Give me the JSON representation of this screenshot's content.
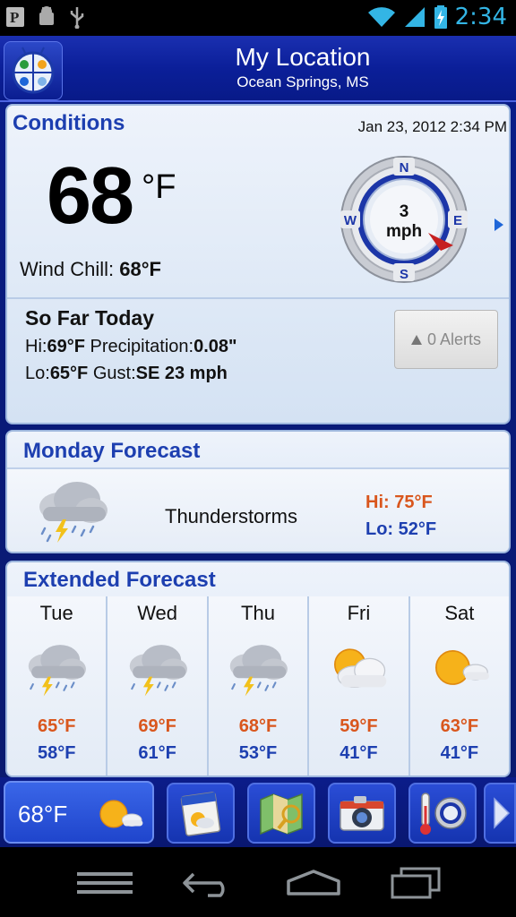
{
  "status_bar": {
    "time": "2:34"
  },
  "header": {
    "title": "My Location",
    "subtitle": "Ocean Springs, MS"
  },
  "conditions": {
    "heading": "Conditions",
    "datetime": "Jan 23, 2012 2:34 PM",
    "temperature": "68",
    "unit": "°F",
    "wind_chill_label": "Wind Chill: ",
    "wind_chill_value": "68°F",
    "wind": {
      "speed": "3",
      "unit": "mph",
      "directions": {
        "n": "N",
        "e": "E",
        "s": "S",
        "w": "W"
      }
    },
    "so_far_today": {
      "heading": "So Far Today",
      "hi_label": "Hi:",
      "hi_value": "69°F",
      "precip_label": "Precipitation:",
      "precip_value": "0.08\"",
      "lo_label": "Lo:",
      "lo_value": "65°F",
      "gust_label": "Gust:",
      "gust_value": "SE 23 mph"
    },
    "alerts_label": "0 Alerts"
  },
  "today_forecast": {
    "heading": "Monday Forecast",
    "condition": "Thunderstorms",
    "hi": "Hi: 75°F",
    "lo": "Lo: 52°F"
  },
  "extended": {
    "heading": "Extended Forecast",
    "days": [
      {
        "name": "Tue",
        "icon": "thunderstorm-icon",
        "hi": "65°F",
        "lo": "58°F"
      },
      {
        "name": "Wed",
        "icon": "thunderstorm-icon",
        "hi": "69°F",
        "lo": "61°F"
      },
      {
        "name": "Thu",
        "icon": "thunderstorm-icon",
        "hi": "68°F",
        "lo": "53°F"
      },
      {
        "name": "Fri",
        "icon": "partly-cloudy-icon",
        "hi": "59°F",
        "lo": "41°F"
      },
      {
        "name": "Sat",
        "icon": "mostly-sunny-icon",
        "hi": "63°F",
        "lo": "41°F"
      }
    ]
  },
  "toolbar": {
    "current_temp": "68°F"
  },
  "colors": {
    "accent": "#1d3fb0",
    "hi": "#d9561d",
    "lo": "#1d3fb0",
    "header": "#0b1f99"
  }
}
